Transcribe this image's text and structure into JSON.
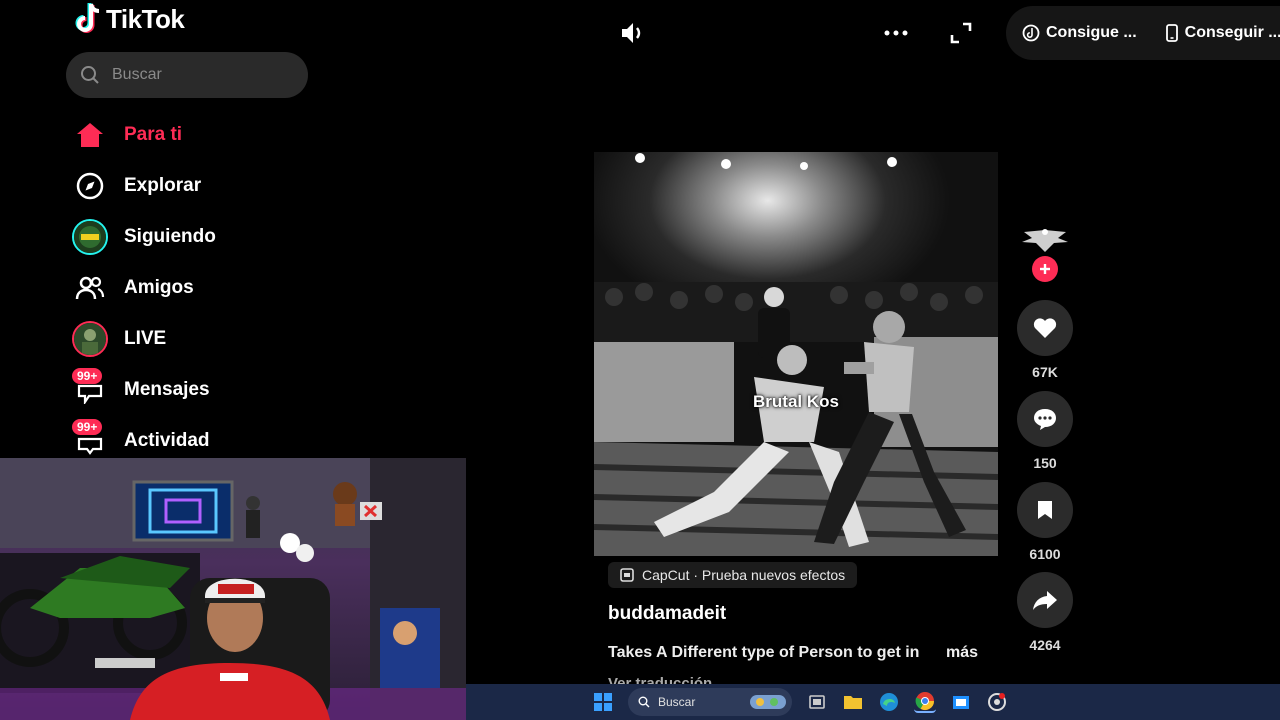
{
  "app": {
    "name": "TikTok"
  },
  "search": {
    "placeholder": "Buscar"
  },
  "nav": [
    {
      "label": "Para ti",
      "icon": "home-icon",
      "active": true
    },
    {
      "label": "Explorar",
      "icon": "compass-icon"
    },
    {
      "label": "Siguiendo",
      "icon": "following-avatar-icon"
    },
    {
      "label": "Amigos",
      "icon": "friends-icon"
    },
    {
      "label": "LIVE",
      "icon": "live-avatar-icon"
    },
    {
      "label": "Mensajes",
      "icon": "messages-icon",
      "badge": "99+"
    },
    {
      "label": "Actividad",
      "icon": "activity-icon",
      "badge": "99+"
    }
  ],
  "top": {
    "get_coins_label": "Consigue ...",
    "get_app_label": "Conseguir ..."
  },
  "video": {
    "caption_overlay": "Brutal Kos",
    "effect_label": "CapCut · Prueba nuevos efectos",
    "username": "buddamadeit",
    "description": "Takes A Different type of Person to get in",
    "more_label": "más",
    "translate_label": "Ver traducción"
  },
  "actions": {
    "likes": "67K",
    "comments": "150",
    "saves": "6100",
    "shares": "4264"
  },
  "taskbar": {
    "search_label": "Buscar"
  },
  "colors": {
    "accent": "#fe2c55",
    "background": "#000000",
    "action_bg": "#2b2b2b",
    "taskbar": "#1b2847"
  }
}
